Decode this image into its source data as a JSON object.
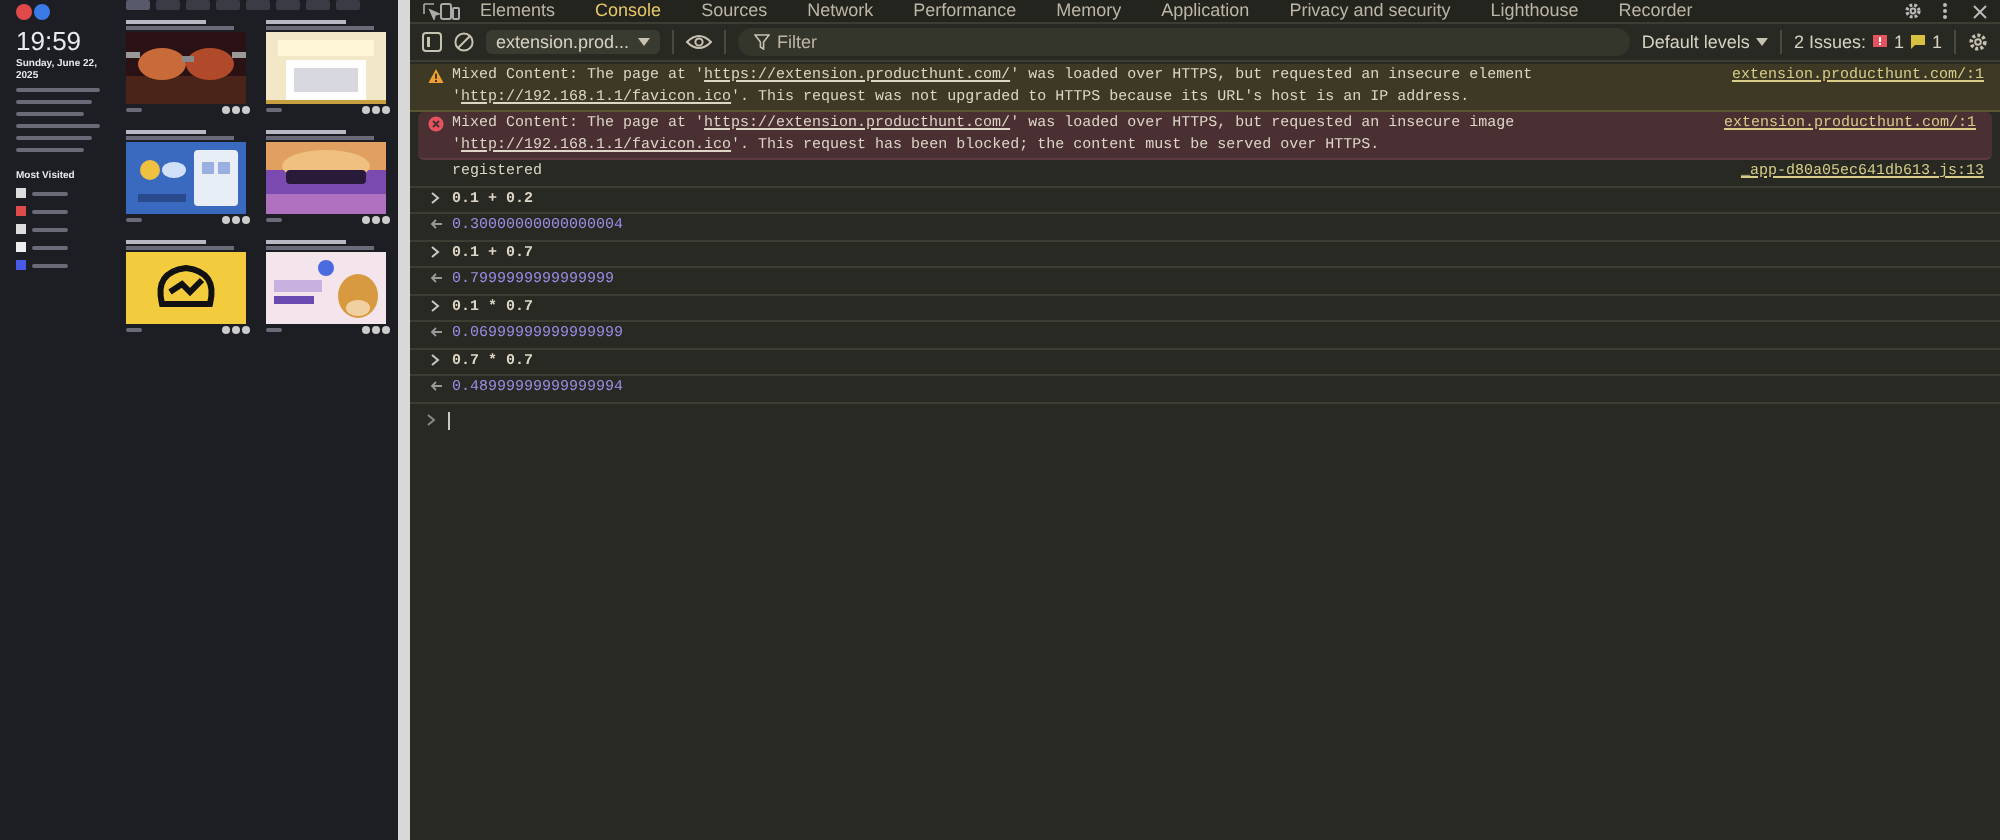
{
  "browser_page": {
    "time": "19:59",
    "date": "Sunday, June 22, 2025",
    "most_visited_title": "Most Visited",
    "nav_tabs": [
      {
        "selected": true
      },
      {
        "selected": false
      },
      {
        "selected": false
      },
      {
        "selected": false
      },
      {
        "selected": false
      },
      {
        "selected": false
      },
      {
        "selected": false
      },
      {
        "selected": false
      }
    ]
  },
  "devtools": {
    "tabs": [
      {
        "label": "Elements",
        "selected": false
      },
      {
        "label": "Console",
        "selected": true
      },
      {
        "label": "Sources",
        "selected": false
      },
      {
        "label": "Network",
        "selected": false
      },
      {
        "label": "Performance",
        "selected": false
      },
      {
        "label": "Memory",
        "selected": false
      },
      {
        "label": "Application",
        "selected": false
      },
      {
        "label": "Privacy and security",
        "selected": false
      },
      {
        "label": "Lighthouse",
        "selected": false
      },
      {
        "label": "Recorder",
        "selected": false
      }
    ],
    "toolbar": {
      "context": "extension.prod...",
      "filter_placeholder": "Filter",
      "levels": "Default levels",
      "issues_label": "2 Issues:",
      "error_issues": "1",
      "info_issues": "1"
    },
    "messages": [
      {
        "kind": "warning",
        "segments": [
          {
            "text": "Mixed Content: The page at '",
            "link": false
          },
          {
            "text": "https://extension.producthunt.com/",
            "link": true
          },
          {
            "text": "' was loaded over HTTPS, but requested an insecure element '",
            "link": false
          },
          {
            "text": "http://192.168.1.1/favicon.ico",
            "link": true
          },
          {
            "text": "'. This request was not upgraded to HTTPS because its URL's host is an IP address.",
            "link": false
          }
        ],
        "source": "extension.producthunt.com/:1"
      },
      {
        "kind": "error",
        "segments": [
          {
            "text": "Mixed Content: The page at '",
            "link": false
          },
          {
            "text": "https://extension.producthunt.com/",
            "link": true
          },
          {
            "text": "' was loaded over HTTPS, but requested an insecure image '",
            "link": false
          },
          {
            "text": "http://192.168.1.1/favicon.ico",
            "link": true
          },
          {
            "text": "'. This request has been blocked; the content must be served over HTTPS.",
            "link": false
          }
        ],
        "source": "extension.producthunt.com/:1"
      },
      {
        "kind": "log",
        "segments": [
          {
            "text": "registered",
            "link": false
          }
        ],
        "source": "_app-d80a05ec641db613.js:13"
      },
      {
        "kind": "input",
        "segments": [
          {
            "text": "0.1 + 0.2",
            "link": false
          }
        ]
      },
      {
        "kind": "result",
        "segments": [
          {
            "text": "0.30000000000000004",
            "link": false
          }
        ]
      },
      {
        "kind": "input",
        "segments": [
          {
            "text": "0.1 + 0.7",
            "link": false
          }
        ]
      },
      {
        "kind": "result",
        "segments": [
          {
            "text": "0.7999999999999999",
            "link": false
          }
        ]
      },
      {
        "kind": "input",
        "segments": [
          {
            "text": "0.1 * 0.7",
            "link": false
          }
        ]
      },
      {
        "kind": "result",
        "segments": [
          {
            "text": "0.06999999999999999",
            "link": false
          }
        ]
      },
      {
        "kind": "input",
        "segments": [
          {
            "text": "0.7 * 0.7",
            "link": false
          }
        ]
      },
      {
        "kind": "result",
        "segments": [
          {
            "text": "0.48999999999999994",
            "link": false
          }
        ]
      }
    ]
  }
}
